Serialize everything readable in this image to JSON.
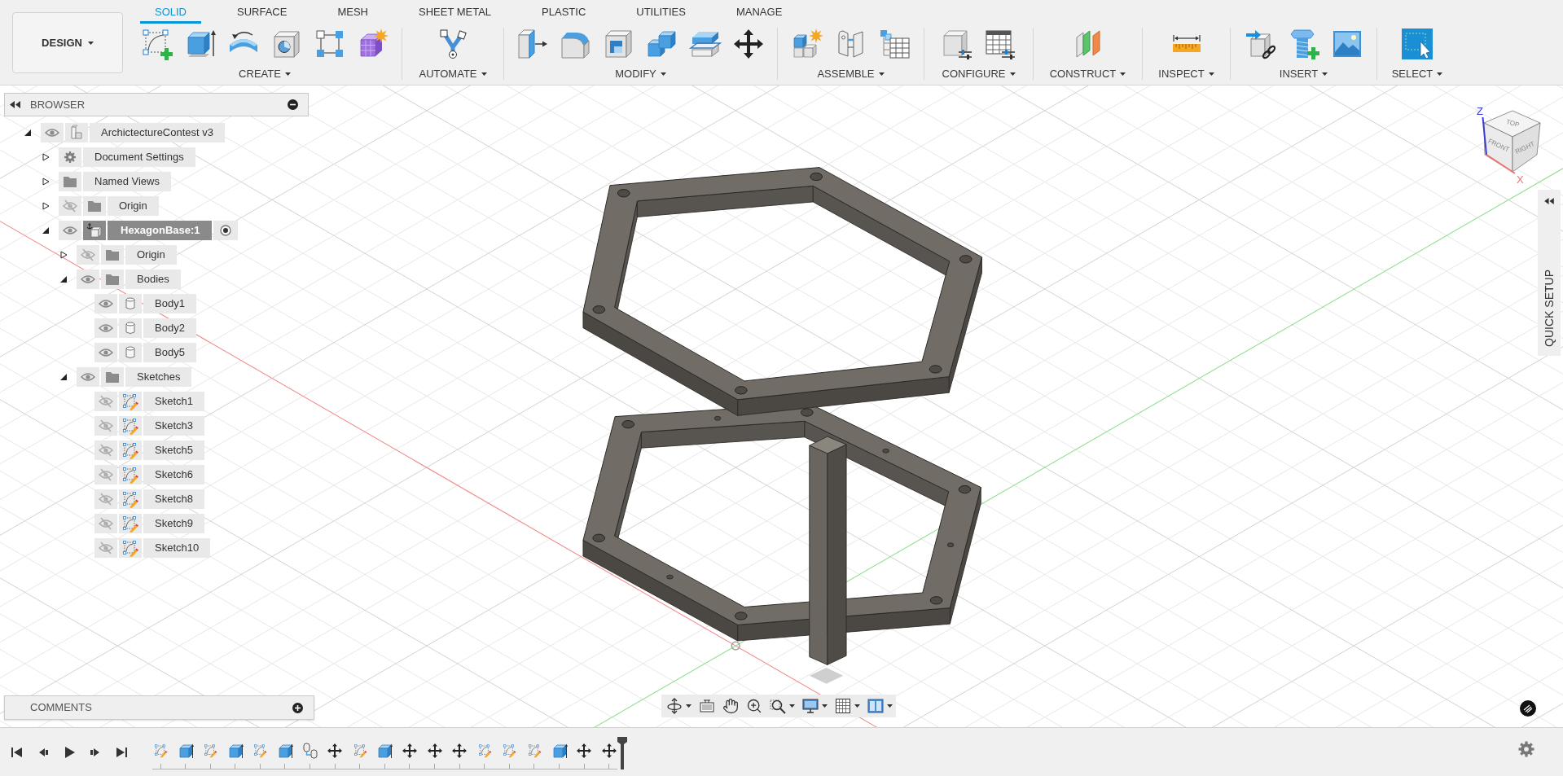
{
  "workspace_menu": {
    "label": "DESIGN"
  },
  "tabs": [
    {
      "label": "SOLID",
      "selected": true
    },
    {
      "label": "SURFACE",
      "selected": false
    },
    {
      "label": "MESH",
      "selected": false
    },
    {
      "label": "SHEET METAL",
      "selected": false
    },
    {
      "label": "PLASTIC",
      "selected": false
    },
    {
      "label": "UTILITIES",
      "selected": false
    },
    {
      "label": "MANAGE",
      "selected": false
    }
  ],
  "toolbar_groups": [
    {
      "label": "CREATE",
      "tools": [
        {
          "kind": "sketch"
        },
        {
          "kind": "extrude"
        },
        {
          "kind": "revolve"
        },
        {
          "kind": "hole"
        },
        {
          "kind": "pattern"
        },
        {
          "kind": "form"
        }
      ]
    },
    {
      "label": "AUTOMATE",
      "tools": [
        {
          "kind": "automate"
        }
      ]
    },
    {
      "label": "MODIFY",
      "tools": [
        {
          "kind": "press_pull"
        },
        {
          "kind": "fillet"
        },
        {
          "kind": "shell"
        },
        {
          "kind": "combine"
        },
        {
          "kind": "split"
        },
        {
          "kind": "move"
        }
      ]
    },
    {
      "label": "ASSEMBLE",
      "tools": [
        {
          "kind": "new_component"
        },
        {
          "kind": "joint"
        },
        {
          "kind": "bom"
        }
      ]
    },
    {
      "label": "CONFIGURE",
      "tools": [
        {
          "kind": "configure_body"
        },
        {
          "kind": "configure_table"
        }
      ]
    },
    {
      "label": "CONSTRUCT",
      "tools": [
        {
          "kind": "planes"
        }
      ]
    },
    {
      "label": "INSPECT",
      "tools": [
        {
          "kind": "measure"
        }
      ]
    },
    {
      "label": "INSERT",
      "tools": [
        {
          "kind": "insert_derive"
        },
        {
          "kind": "insert_fastener"
        },
        {
          "kind": "insert_image"
        }
      ]
    },
    {
      "label": "SELECT",
      "tools": [
        {
          "kind": "select"
        }
      ]
    }
  ],
  "browser": {
    "title": "BROWSER",
    "tree": [
      {
        "label": "ArchictectureContest v3",
        "kind": "design",
        "visible": true,
        "expanded": true,
        "selected": false,
        "children": [
          {
            "label": "Document Settings",
            "kind": "settings",
            "expanded": false,
            "selected": false
          },
          {
            "label": "Named Views",
            "kind": "folder",
            "expanded": false,
            "selected": false
          },
          {
            "label": "Origin",
            "kind": "folder",
            "visible": false,
            "expanded": false,
            "selected": false
          },
          {
            "label": "HexagonBase:1",
            "kind": "component",
            "visible": true,
            "expanded": true,
            "selected": true,
            "children": [
              {
                "label": "Origin",
                "kind": "folder",
                "visible": false,
                "expanded": false,
                "selected": false
              },
              {
                "label": "Bodies",
                "kind": "folder",
                "visible": true,
                "expanded": true,
                "selected": false,
                "children": [
                  {
                    "label": "Body1",
                    "kind": "body",
                    "visible": true,
                    "selected": false
                  },
                  {
                    "label": "Body2",
                    "kind": "body",
                    "visible": true,
                    "selected": false
                  },
                  {
                    "label": "Body5",
                    "kind": "body",
                    "visible": true,
                    "selected": false
                  }
                ]
              },
              {
                "label": "Sketches",
                "kind": "folder",
                "visible": true,
                "expanded": true,
                "selected": false,
                "children": [
                  {
                    "label": "Sketch1",
                    "kind": "sketch",
                    "visible": false,
                    "selected": false
                  },
                  {
                    "label": "Sketch3",
                    "kind": "sketch",
                    "visible": false,
                    "selected": false
                  },
                  {
                    "label": "Sketch5",
                    "kind": "sketch",
                    "visible": false,
                    "selected": false
                  },
                  {
                    "label": "Sketch6",
                    "kind": "sketch",
                    "visible": false,
                    "selected": false
                  },
                  {
                    "label": "Sketch8",
                    "kind": "sketch",
                    "visible": false,
                    "selected": false
                  },
                  {
                    "label": "Sketch9",
                    "kind": "sketch",
                    "visible": false,
                    "selected": false
                  },
                  {
                    "label": "Sketch10",
                    "kind": "sketch",
                    "visible": false,
                    "selected": false
                  }
                ]
              }
            ]
          }
        ]
      }
    ]
  },
  "comments": {
    "title": "COMMENTS"
  },
  "view_cube": {
    "top": "TOP",
    "front": "FRONT",
    "right": "RIGHT",
    "axis_z": "Z",
    "axis_x": "X"
  },
  "quick_setup": {
    "label": "QUICK SETUP"
  },
  "navigation_bar": {
    "tools": [
      {
        "kind": "orbit",
        "menu": true
      },
      {
        "kind": "look_at",
        "menu": false
      },
      {
        "kind": "pan",
        "menu": false
      },
      {
        "kind": "zoom",
        "menu": false
      },
      {
        "kind": "zoom_window",
        "menu": true
      },
      {
        "kind": "display",
        "menu": true
      },
      {
        "kind": "grid",
        "menu": true
      },
      {
        "kind": "viewports",
        "menu": true
      }
    ]
  },
  "timeline": {
    "features": [
      {
        "kind": "sketch"
      },
      {
        "kind": "extrude"
      },
      {
        "kind": "sketch"
      },
      {
        "kind": "extrude"
      },
      {
        "kind": "sketch"
      },
      {
        "kind": "extrude"
      },
      {
        "kind": "joint"
      },
      {
        "kind": "move"
      },
      {
        "kind": "sketch"
      },
      {
        "kind": "extrude"
      },
      {
        "kind": "move"
      },
      {
        "kind": "move"
      },
      {
        "kind": "move"
      },
      {
        "kind": "sketch"
      },
      {
        "kind": "sketch"
      },
      {
        "kind": "sketch"
      },
      {
        "kind": "extrude"
      },
      {
        "kind": "move"
      },
      {
        "kind": "move"
      }
    ]
  }
}
